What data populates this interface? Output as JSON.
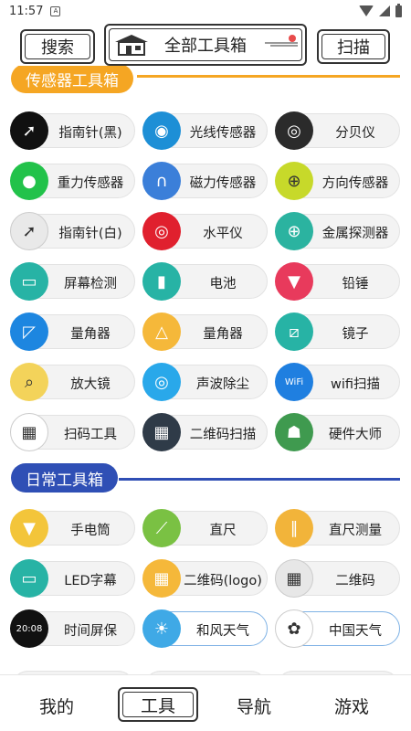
{
  "status_bar": {
    "time": "11:57",
    "notification_icon": "A"
  },
  "header": {
    "search_label": "搜索",
    "title": "全部工具箱",
    "scan_label": "扫描"
  },
  "sections": [
    {
      "title": "传感器工具箱",
      "color": "#f5a623",
      "tools": [
        {
          "label": "指南针(黑)",
          "icon": "compass-black-icon",
          "glyph": "➚",
          "color": "#111111"
        },
        {
          "label": "光线传感器",
          "icon": "light-sensor-icon",
          "glyph": "◉",
          "color": "#1d8fd6"
        },
        {
          "label": "分贝仪",
          "icon": "decibel-meter-icon",
          "glyph": "◎",
          "color": "#2b2b2b"
        },
        {
          "label": "重力传感器",
          "icon": "gravity-sensor-icon",
          "glyph": "●",
          "color": "#22c24a"
        },
        {
          "label": "磁力传感器",
          "icon": "magnet-icon",
          "glyph": "∩",
          "color": "#3b7fd9"
        },
        {
          "label": "方向传感器",
          "icon": "direction-sensor-icon",
          "glyph": "⊕",
          "color": "#c7d92a"
        },
        {
          "label": "指南针(白)",
          "icon": "compass-white-icon",
          "glyph": "➚",
          "color": "#e9e9e9"
        },
        {
          "label": "水平仪",
          "icon": "level-icon",
          "glyph": "◎",
          "color": "#e0202e"
        },
        {
          "label": "金属探测器",
          "icon": "metal-detector-icon",
          "glyph": "⊕",
          "color": "#2bb3a0"
        },
        {
          "label": "屏幕检测",
          "icon": "screen-test-icon",
          "glyph": "▭",
          "color": "#27b3a5"
        },
        {
          "label": "电池",
          "icon": "battery-icon",
          "glyph": "▮",
          "color": "#27b3a5"
        },
        {
          "label": "铅锤",
          "icon": "plumb-icon",
          "glyph": "▼",
          "color": "#e83a5c"
        },
        {
          "label": "量角器",
          "icon": "protractor-blue-icon",
          "glyph": "◸",
          "color": "#1d86e0"
        },
        {
          "label": "量角器",
          "icon": "protractor-orange-icon",
          "glyph": "△",
          "color": "#f5b83a"
        },
        {
          "label": "镜子",
          "icon": "mirror-icon",
          "glyph": "⧄",
          "color": "#27b3a5"
        },
        {
          "label": "放大镜",
          "icon": "magnifier-icon",
          "glyph": "⌕",
          "color": "#f3d35a"
        },
        {
          "label": "声波除尘",
          "icon": "sound-wave-icon",
          "glyph": "◎",
          "color": "#29a8ea"
        },
        {
          "label": "wifi扫描",
          "icon": "wifi-scan-icon",
          "glyph": "WiFi",
          "color": "#1f7fe0"
        },
        {
          "label": "扫码工具",
          "icon": "scan-code-icon",
          "glyph": "▦",
          "color": "#ffffff"
        },
        {
          "label": "二维码扫描",
          "icon": "qr-scan-icon",
          "glyph": "▦",
          "color": "#2f3b48"
        },
        {
          "label": "硬件大师",
          "icon": "android-icon",
          "glyph": "☗",
          "color": "#3f9a4f"
        }
      ]
    },
    {
      "title": "日常工具箱",
      "color": "#2f4fb5",
      "tools": [
        {
          "label": "手电筒",
          "icon": "flashlight-icon",
          "glyph": "▼",
          "color": "#f3c53a"
        },
        {
          "label": "直尺",
          "icon": "ruler-icon",
          "glyph": "⟋",
          "color": "#7ac143"
        },
        {
          "label": "直尺测量",
          "icon": "ruler-measure-icon",
          "glyph": "∥",
          "color": "#f2b43a"
        },
        {
          "label": "LED字幕",
          "icon": "led-monitor-icon",
          "glyph": "▭",
          "color": "#27b3a5"
        },
        {
          "label": "二维码(logo)",
          "icon": "qr-logo-icon",
          "glyph": "▦",
          "color": "#f5b83a"
        },
        {
          "label": "二维码",
          "icon": "qr-code-icon",
          "glyph": "▦",
          "color": "#e7e7e7"
        },
        {
          "label": "时间屏保",
          "icon": "clock-screensaver-icon",
          "glyph": "20:08",
          "color": "#111111"
        },
        {
          "label": "和风天气",
          "icon": "weather-icon",
          "glyph": "☀",
          "color": "#3fa9e6"
        },
        {
          "label": "中国天气",
          "icon": "china-weather-icon",
          "glyph": "✿",
          "color": "#ffffff"
        }
      ]
    }
  ],
  "bottom_nav": {
    "items": [
      "我的",
      "工具",
      "导航",
      "游戏"
    ],
    "active_index": 1
  }
}
